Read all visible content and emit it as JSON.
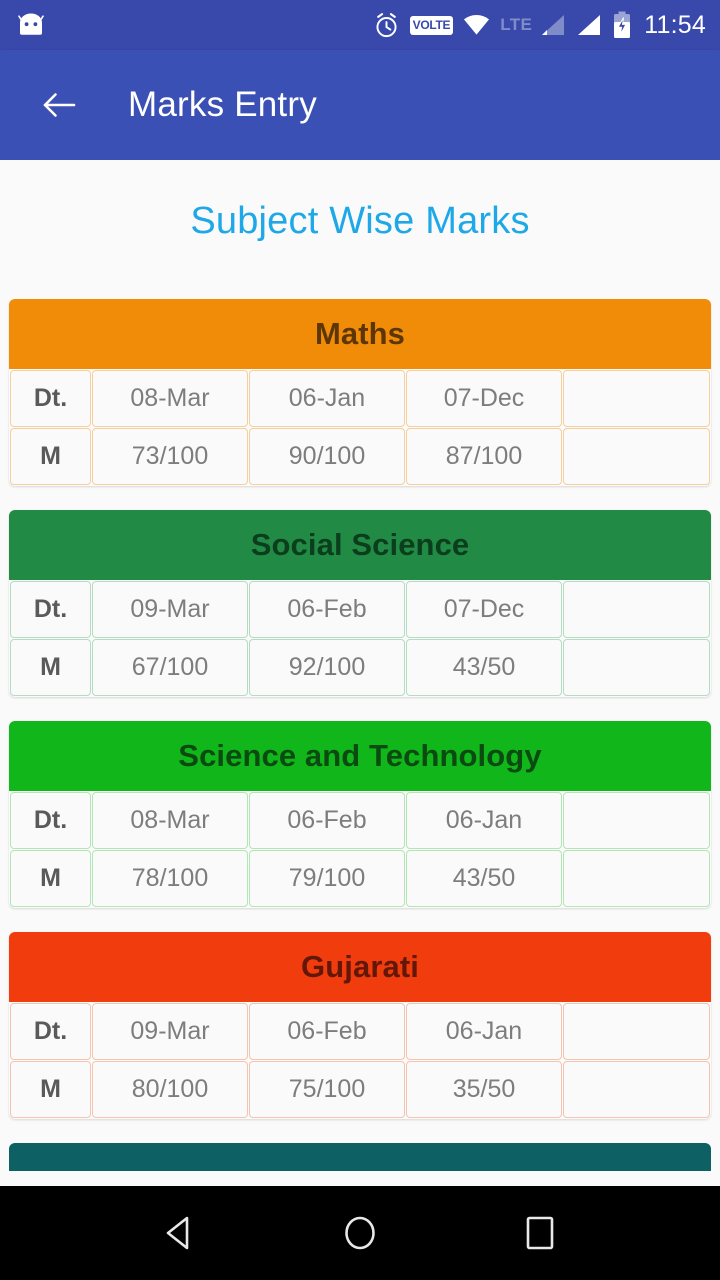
{
  "status_bar": {
    "app_icon": "android-head-icon",
    "icons": [
      "alarm-icon",
      "volte-icon",
      "wifi-icon",
      "lte-icon",
      "signal-bars-icon-1",
      "signal-bars-icon-2",
      "battery-charging-icon"
    ],
    "volte_label": "VOLTE",
    "lte_label": "LTE",
    "clock": "11:54",
    "background_color": "#3949ab"
  },
  "app_bar": {
    "back_icon": "back-arrow-icon",
    "title": "Marks Entry",
    "background_color": "#3b50b4",
    "title_color": "#ffffff"
  },
  "page": {
    "title": "Subject Wise Marks",
    "title_color": "#1fa8e8",
    "background_color": "#fafafa"
  },
  "table_labels": {
    "date_row": "Dt.",
    "marks_row": "M"
  },
  "subjects": [
    {
      "name": "Maths",
      "header_color": "#f08c08",
      "header_text_color": "#5c3606",
      "border_color": "#f6cf9c",
      "dates": [
        "08-Mar",
        "06-Jan",
        "07-Dec",
        ""
      ],
      "marks": [
        "73/100",
        "90/100",
        "87/100",
        ""
      ]
    },
    {
      "name": "Social Science",
      "header_color": "#218b46",
      "header_text_color": "#0c3d1c",
      "border_color": "#b4dcc2",
      "dates": [
        "09-Mar",
        "06-Feb",
        "07-Dec",
        ""
      ],
      "marks": [
        "67/100",
        "92/100",
        "43/50",
        ""
      ]
    },
    {
      "name": "Science and Technology",
      "header_color": "#11b61a",
      "header_text_color": "#0b4a11",
      "border_color": "#b2e6b4",
      "dates": [
        "08-Mar",
        "06-Feb",
        "06-Jan",
        ""
      ],
      "marks": [
        "78/100",
        "79/100",
        "43/50",
        ""
      ]
    },
    {
      "name": "Gujarati",
      "header_color": "#f13d0d",
      "header_text_color": "#631708",
      "border_color": "#f6c3b0",
      "dates": [
        "09-Mar",
        "06-Feb",
        "06-Jan",
        ""
      ],
      "marks": [
        "80/100",
        "75/100",
        "35/50",
        ""
      ]
    }
  ],
  "next_card": {
    "header_color": "#0d6064"
  },
  "nav_bar": {
    "background_color": "#000000",
    "buttons": [
      "back-triangle-icon",
      "home-circle-icon",
      "recents-square-icon"
    ]
  }
}
